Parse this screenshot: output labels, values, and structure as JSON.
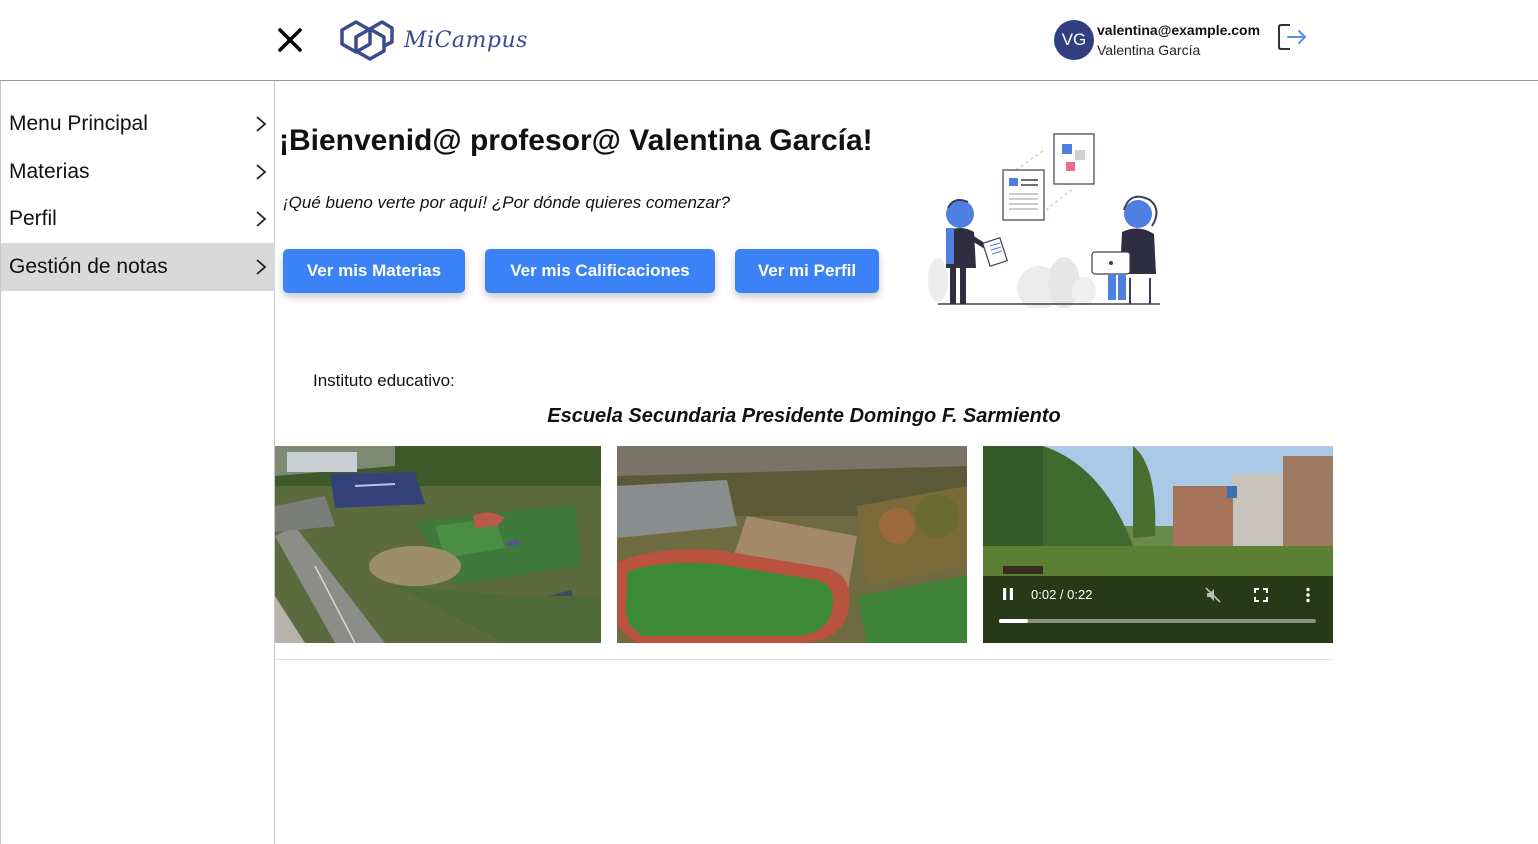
{
  "app": {
    "name": "MiCampus"
  },
  "user": {
    "initials": "VG",
    "email": "valentina@example.com",
    "name": "Valentina García"
  },
  "sidebar": {
    "items": [
      {
        "label": "Menu Principal",
        "active": false
      },
      {
        "label": "Materias",
        "active": false
      },
      {
        "label": "Perfil",
        "active": false
      },
      {
        "label": "Gestión de notas",
        "active": true
      }
    ]
  },
  "welcome": {
    "title": "¡Bienvenid@ profesor@ Valentina García!",
    "subtitle": "¡Qué bueno verte por aquí! ¿Por dónde quieres comenzar?"
  },
  "actions": {
    "materias": "Ver mis Materias",
    "calificaciones": "Ver mis Calificaciones",
    "perfil": "Ver mi Perfil"
  },
  "institute": {
    "label": "Instituto educativo:",
    "name": "Escuela Secundaria Presidente Domingo F. Sarmiento"
  },
  "video": {
    "time": "0:02 / 0:22",
    "progress": 0.09,
    "playing": true,
    "muted": true
  },
  "colors": {
    "accent": "#3b82f6",
    "brand": "#3a4a8c",
    "avatar": "#2f3f7f",
    "active_item": "#d9d9d9"
  },
  "icons": {
    "close": "close-icon",
    "logo": "hexagon-logo-icon",
    "logout": "logout-icon",
    "chevron": "chevron-right-icon",
    "pause": "pause-icon",
    "mute": "volume-muted-icon",
    "fullscreen": "fullscreen-icon",
    "more": "more-vertical-icon"
  }
}
